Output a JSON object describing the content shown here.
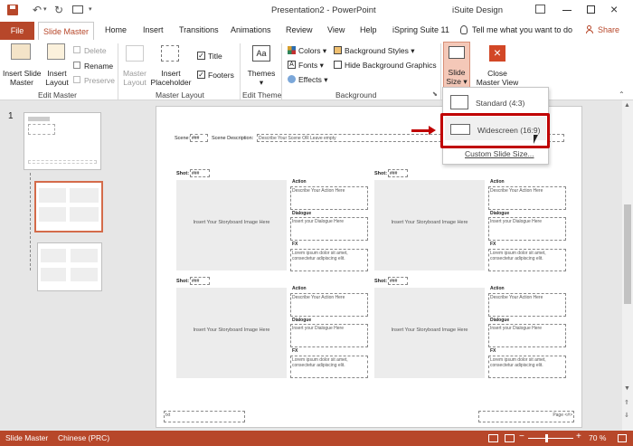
{
  "title_bar": {
    "doc_title": "Presentation2",
    "sep": "-",
    "app_name": "PowerPoint",
    "account": "iSuite Design"
  },
  "tabs": [
    "File",
    "Slide Master",
    "Home",
    "Insert",
    "Transitions",
    "Animations",
    "Review",
    "View",
    "Help",
    "iSpring Suite 11"
  ],
  "tell_me": "Tell me what you want to do",
  "share": "Share",
  "ribbon": {
    "insert_slide_master": [
      "Insert Slide",
      "Master"
    ],
    "insert_layout": [
      "Insert",
      "Layout"
    ],
    "delete": "Delete",
    "rename": "Rename",
    "preserve": "Preserve",
    "master_layout": [
      "Master",
      "Layout"
    ],
    "insert_placeholder": [
      "Insert",
      "Placeholder"
    ],
    "title_cb": "Title",
    "footers_cb": "Footers",
    "themes": "Themes",
    "colors": "Colors",
    "fonts": "Fonts",
    "effects": "Effects",
    "background_styles": "Background Styles",
    "hide_bg": "Hide Background Graphics",
    "slide_size": [
      "Slide",
      "Size"
    ],
    "close_master": [
      "Close",
      "Master View"
    ],
    "groups": {
      "edit_master": "Edit Master",
      "master_layout": "Master Layout",
      "edit_theme": "Edit Theme",
      "background": "Background"
    }
  },
  "slide_size_menu": {
    "standard": "Standard (4:3)",
    "widescreen": "Widescreen (16:9)",
    "custom": "Custom Slide Size..."
  },
  "slide_panel": {
    "number": "1"
  },
  "slide": {
    "scene_label": "Scene:",
    "scene_value": "###",
    "scene_desc_label": "Scene Description:",
    "scene_desc_value": "Describe Your Scene OR Leave empty",
    "shots": [
      {
        "label": "Shot:",
        "value": "###"
      },
      {
        "label": "Shot:",
        "value": "###"
      },
      {
        "label": "Shot:",
        "value": "###"
      },
      {
        "label": "Shot:",
        "value": "###"
      }
    ],
    "storyboard_ph": "Insert Your Storyboard Image Here",
    "action_label": "Action",
    "action_ph": "Describe Your Action Here",
    "dialogue_label": "Dialogue",
    "dialogue_ph": "Insert your Dialogue Here",
    "fx_label": "FX",
    "fx_ph": "Lorem ipsum dolor sit amet, consectetur adipiscing elit.",
    "footer_left": "txt",
    "footer_right": "Page <#>"
  },
  "status": {
    "view": "Slide Master",
    "language": "Chinese (PRC)",
    "zoom": "70 %"
  },
  "colors": {
    "accent": "#b7472a",
    "highlight": "#c00000"
  }
}
